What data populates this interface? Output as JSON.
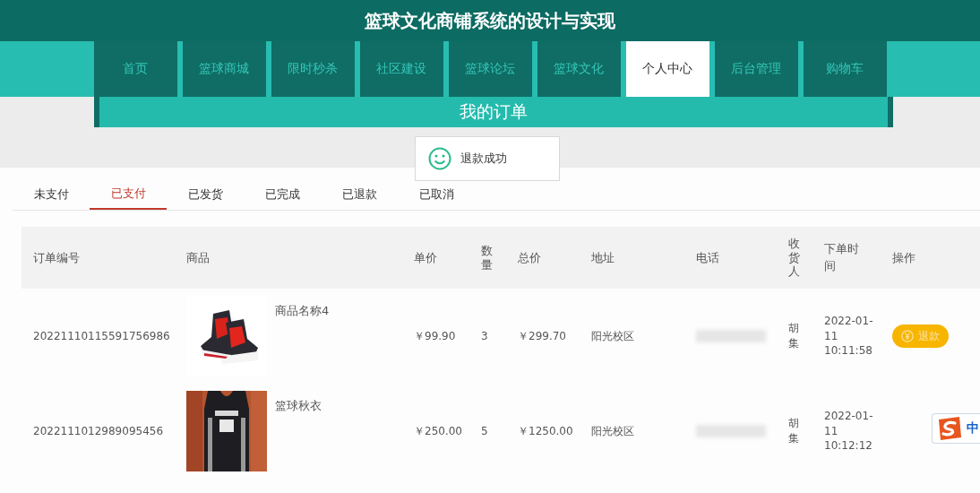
{
  "header": {
    "title": "篮球文化商铺系统的设计与实现"
  },
  "nav": [
    {
      "label": "首页",
      "selected": false
    },
    {
      "label": "篮球商城",
      "selected": false
    },
    {
      "label": "限时秒杀",
      "selected": false
    },
    {
      "label": "社区建设",
      "selected": false
    },
    {
      "label": "篮球论坛",
      "selected": false
    },
    {
      "label": "篮球文化",
      "selected": false
    },
    {
      "label": "个人中心",
      "selected": true
    },
    {
      "label": "后台管理",
      "selected": false
    },
    {
      "label": "购物车",
      "selected": false
    }
  ],
  "banner": {
    "title": "我的订单"
  },
  "toast": {
    "message": "退款成功"
  },
  "status_tabs": [
    {
      "label": "未支付",
      "selected": false
    },
    {
      "label": "已支付",
      "selected": true
    },
    {
      "label": "已发货",
      "selected": false
    },
    {
      "label": "已完成",
      "selected": false
    },
    {
      "label": "已退款",
      "selected": false
    },
    {
      "label": "已取消",
      "selected": false
    }
  ],
  "table": {
    "columns": [
      "订单编号",
      "商品",
      "单价",
      "数量",
      "总价",
      "地址",
      "电话",
      "收货人",
      "下单时间",
      "操作"
    ],
    "rows": [
      {
        "order_no": "20221110115591756986",
        "product": {
          "kind": "picture",
          "name": "商品名称4"
        },
        "price": "￥99.90",
        "quantity": "3",
        "total": "￥299.70",
        "address": "阳光校区",
        "receiver": "胡集",
        "time": "2022-01-11 10:11:58",
        "action": {
          "kind": "refund",
          "label": "退款"
        }
      },
      {
        "order_no": "2022111012989095456",
        "product": {
          "kind": "picture",
          "name": "篮球秋衣"
        },
        "price": "￥250.00",
        "quantity": "5",
        "total": "￥1250.00",
        "address": "阳光校区",
        "receiver": "胡集",
        "time": "2022-01-11 10:12:12"
      }
    ]
  },
  "ime": {
    "label": "中"
  }
}
